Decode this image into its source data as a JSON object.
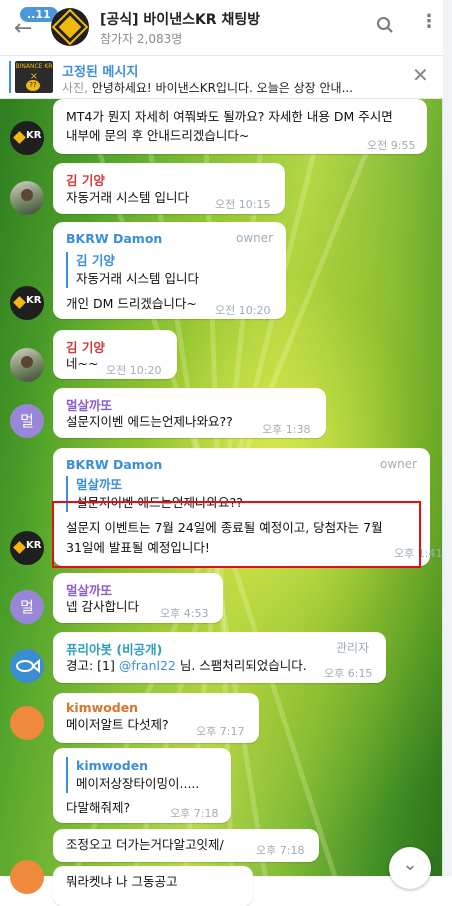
{
  "header": {
    "unread_count": "..11",
    "title": "[공식] 바이낸스KR 채팅방",
    "subtitle": "참가자 2,083명"
  },
  "pinned": {
    "title": "고정된 메시지",
    "prefix": "사진,",
    "text": "안녕하세요! 바이낸스KR입니다. 오늘은 상장 안내...",
    "thumb_brand": "BINANCE KR",
    "thumb_x": "×"
  },
  "messages": [
    {
      "id": "m1",
      "lines": [
        "MT4가 뭔지 자세히 여쭤봐도 될까요? 자세한 내용 DM 주시면",
        "내부에 문의 후 안내드리겠습니다~"
      ],
      "time": "오전 9:55"
    },
    {
      "id": "m2",
      "sender": "김 기양",
      "lines": [
        "자동거래 시스템 입니다"
      ],
      "time": "오전 10:15"
    },
    {
      "id": "m3",
      "sender": "BKRW Damon",
      "role": "owner",
      "reply_name": "김 기양",
      "reply_text": "자동거래 시스템 입니다",
      "lines": [
        "개인 DM 드리겠습니다~"
      ],
      "time": "오전 10:20"
    },
    {
      "id": "m4",
      "sender": "김 기양",
      "lines": [
        "네~~"
      ],
      "time": "오전 10:20"
    },
    {
      "id": "m5",
      "sender": "멀살까또",
      "lines": [
        "설문지이벤 에드는언제나와요??"
      ],
      "time": "오후 1:38",
      "avatar": "멀"
    },
    {
      "id": "m6",
      "sender": "BKRW Damon",
      "role": "owner",
      "reply_name": "멀살까또",
      "reply_text": "설문지이벤 에드는언제나와요??",
      "lines": [
        "설문지 이벤트는 7월 24일에 종료될 예정이고, 당첨자는 7월",
        "31일에 발표될 예정입니다!"
      ],
      "time": "오후 1:41"
    },
    {
      "id": "m7",
      "sender": "멀살까또",
      "lines": [
        "넵 감사합니다"
      ],
      "time": "오후 4:53",
      "avatar": "멀"
    },
    {
      "id": "m8",
      "sender": "퓨리아봇 (비공개)",
      "role": "관리자",
      "lines": [
        "경고: [1] @franl22 님. 스팸처리되었습니다."
      ],
      "mention": "@franl22",
      "time": "오후 6:15"
    },
    {
      "id": "m9",
      "sender": "kimwoden",
      "lines": [
        "메이저알트 다섯제?"
      ],
      "time": "오후 7:17"
    },
    {
      "id": "m10",
      "reply_name": "kimwoden",
      "reply_text": "메이저상장타이밍이.....",
      "lines": [
        "다말해줘제?"
      ],
      "time": "오후 7:18"
    },
    {
      "id": "m11",
      "lines": [
        "조정오고 더가는거다알고잇제/"
      ],
      "time": "오후 7:18"
    },
    {
      "id": "m12",
      "lines": [
        "뭐라켓냐 나 그동공고"
      ]
    }
  ],
  "colors": {
    "accent": "#3a8edb",
    "highlight": "#e01010",
    "binance_yellow": "#f0b90b",
    "sender_red": "#d23c3c",
    "sender_purple": "#8c5ec9",
    "sender_teal": "#2f9fb8",
    "sender_orange": "#d9742a"
  },
  "icons": {
    "back": "arrow-left-icon",
    "search": "search-icon",
    "menu": "more-vertical-icon",
    "close": "close-icon",
    "scroll": "chevron-down-icon"
  }
}
